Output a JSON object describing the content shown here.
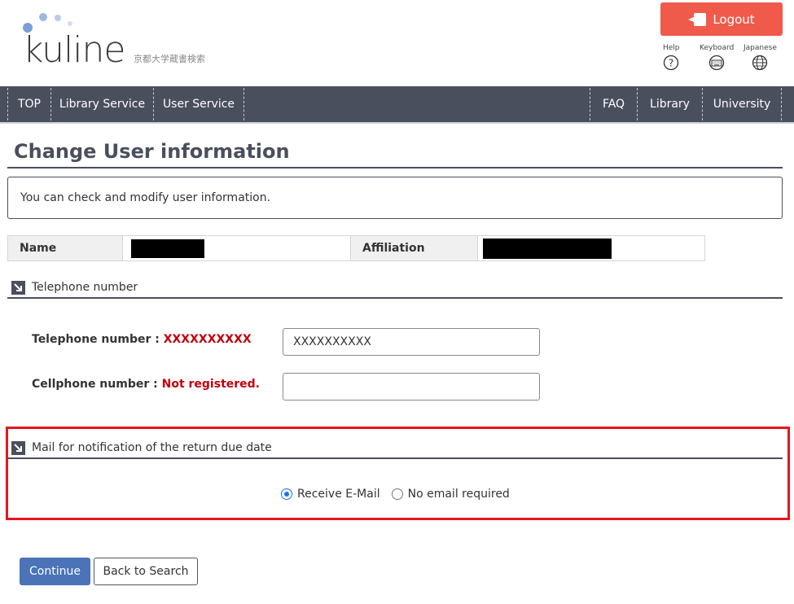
{
  "header": {
    "logo_text": "kuline",
    "logo_sub": "京都大学蔵書検索",
    "logout_label": "Logout",
    "help_label": "Help",
    "keyboard_label": "Keyboard",
    "japanese_label": "Japanese"
  },
  "nav": {
    "left": [
      "TOP",
      "Library Service",
      "User Service"
    ],
    "right": [
      "FAQ",
      "Library",
      "University"
    ]
  },
  "page": {
    "title": "Change User information",
    "info": "You can check and modify user information."
  },
  "user_table": {
    "name_label": "Name",
    "affiliation_label": "Affiliation"
  },
  "phone_section": {
    "heading": "Telephone number",
    "telephone_label": "Telephone number : ",
    "telephone_value": "XXXXXXXXXX",
    "telephone_input": "XXXXXXXXXX",
    "cellphone_label": "Cellphone number : ",
    "cellphone_value": "Not registered.",
    "cellphone_input": ""
  },
  "mail_section": {
    "heading": "Mail for notification of the return due date",
    "option_receive": "Receive E-Mail",
    "option_none": "No email required",
    "selected": "receive"
  },
  "actions": {
    "continue_label": "Continue",
    "back_label": "Back to Search"
  },
  "colors": {
    "nav_bg": "#4a4f5e",
    "logout_bg": "#f05a4a",
    "primary_button": "#4a73b8",
    "highlight_border": "#e8141e",
    "value_red": "#c0000d"
  }
}
